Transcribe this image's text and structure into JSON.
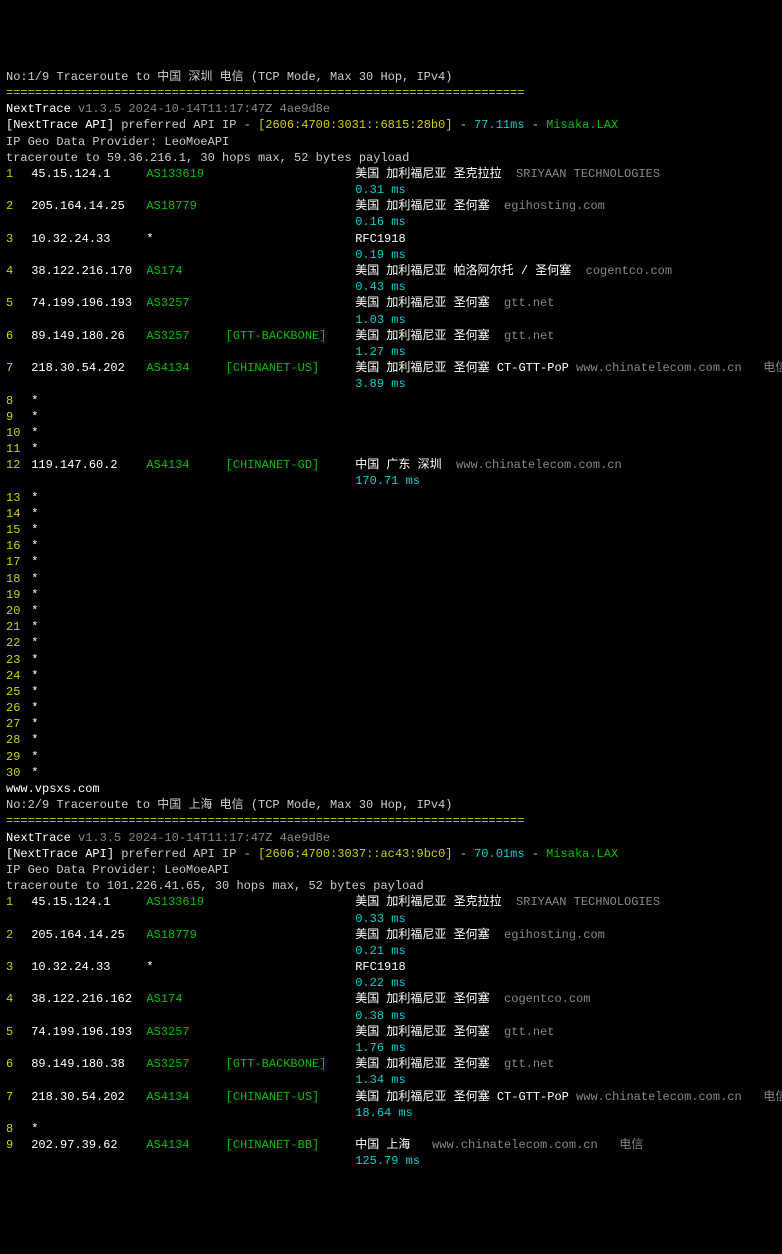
{
  "trace1": {
    "title": "No:1/9 Traceroute to 中国 深圳 电信 (TCP Mode, Max 30 Hop, IPv4)",
    "sep": "========================================================================",
    "nexttrace_label": "NextTrace",
    "nexttrace_ver": " v1.3.5 2024-10-14T11:17:47Z 4ae9d8e",
    "api1": "[NextTrace API]",
    "api2": " preferred API IP - ",
    "api_ip": "[2606:4700:3031::6815:28b0]",
    "api_sep": " - ",
    "api_lat": "77.11ms",
    "api_sep2": " - ",
    "api_loc": "Misaka.LAX",
    "provider": "IP Geo Data Provider: LeoMoeAPI",
    "cmd": "traceroute to 59.36.216.1, 30 hops max, 52 bytes payload",
    "hops": [
      {
        "n": "1",
        "ip": "45.15.124.1",
        "asn": "AS133619",
        "tag": "",
        "geo": "美国 加利福尼亚 圣克拉拉",
        "isp": "  SRIYAAN TECHNOLOGIES",
        "lat": "0.31 ms"
      },
      {
        "n": "2",
        "ip": "205.164.14.25",
        "asn": "AS18779",
        "tag": "",
        "geo": "美国 加利福尼亚 圣何塞",
        "isp": "  egihosting.com",
        "lat": "0.16 ms"
      },
      {
        "n": "3",
        "ip": "10.32.24.33",
        "asn": "*",
        "tag": "",
        "geo": "RFC1918",
        "isp": "",
        "lat": "0.19 ms"
      },
      {
        "n": "4",
        "ip": "38.122.216.170",
        "asn": "AS174",
        "tag": "",
        "geo": "美国 加利福尼亚 帕洛阿尔托 / 圣何塞",
        "isp": "  cogentco.com",
        "lat": "0.43 ms"
      },
      {
        "n": "5",
        "ip": "74.199.196.193",
        "asn": "AS3257",
        "tag": "",
        "geo": "美国 加利福尼亚 圣何塞",
        "isp": "  gtt.net",
        "lat": "1.03 ms"
      },
      {
        "n": "6",
        "ip": "89.149.180.26",
        "asn": "AS3257",
        "tag": "[GTT-BACKBONE]",
        "geo": "美国 加利福尼亚 圣何塞",
        "isp": "  gtt.net",
        "lat": "1.27 ms"
      },
      {
        "n": "7",
        "ip": "218.30.54.202",
        "asn": "AS4134",
        "tag": "[CHINANET-US]",
        "geo": "美国 加利福尼亚 圣何塞 CT-GTT-PoP",
        "isp": " www.chinatelecom.com.cn   电信",
        "lat": "3.89 ms"
      }
    ],
    "stars1": [
      "8",
      "9",
      "10",
      "11"
    ],
    "hop12": {
      "n": "12",
      "ip": "119.147.60.2",
      "asn": "AS4134",
      "tag": "[CHINANET-GD]",
      "geo": "中国 广东 深圳",
      "isp": "  www.chinatelecom.com.cn",
      "lat": "170.71 ms"
    },
    "stars2": [
      "13",
      "14",
      "15",
      "16",
      "17",
      "18",
      "19",
      "20",
      "21",
      "22",
      "23",
      "24",
      "25",
      "26",
      "27",
      "28",
      "29",
      "30"
    ],
    "watermark": "www.vpsxs.com"
  },
  "trace2": {
    "title": "No:2/9 Traceroute to 中国 上海 电信 (TCP Mode, Max 30 Hop, IPv4)",
    "sep": "========================================================================",
    "nexttrace_label": "NextTrace",
    "nexttrace_ver": " v1.3.5 2024-10-14T11:17:47Z 4ae9d8e",
    "api1": "[NextTrace API]",
    "api2": " preferred API IP - ",
    "api_ip": "[2606:4700:3037::ac43:9bc0]",
    "api_sep": " - ",
    "api_lat": "70.01ms",
    "api_sep2": " - ",
    "api_loc": "Misaka.LAX",
    "provider": "IP Geo Data Provider: LeoMoeAPI",
    "cmd": "traceroute to 101.226.41.65, 30 hops max, 52 bytes payload",
    "hops": [
      {
        "n": "1",
        "ip": "45.15.124.1",
        "asn": "AS133619",
        "tag": "",
        "geo": "美国 加利福尼亚 圣克拉拉",
        "isp": "  SRIYAAN TECHNOLOGIES",
        "lat": "0.33 ms"
      },
      {
        "n": "2",
        "ip": "205.164.14.25",
        "asn": "AS18779",
        "tag": "",
        "geo": "美国 加利福尼亚 圣何塞",
        "isp": "  egihosting.com",
        "lat": "0.21 ms"
      },
      {
        "n": "3",
        "ip": "10.32.24.33",
        "asn": "*",
        "tag": "",
        "geo": "RFC1918",
        "isp": "",
        "lat": "0.22 ms"
      },
      {
        "n": "4",
        "ip": "38.122.216.162",
        "asn": "AS174",
        "tag": "",
        "geo": "美国 加利福尼亚 圣何塞",
        "isp": "  cogentco.com",
        "lat": "0.38 ms"
      },
      {
        "n": "5",
        "ip": "74.199.196.193",
        "asn": "AS3257",
        "tag": "",
        "geo": "美国 加利福尼亚 圣何塞",
        "isp": "  gtt.net",
        "lat": "1.76 ms"
      },
      {
        "n": "6",
        "ip": "89.149.180.38",
        "asn": "AS3257",
        "tag": "[GTT-BACKBONE]",
        "geo": "美国 加利福尼亚 圣何塞",
        "isp": "  gtt.net",
        "lat": "1.34 ms"
      },
      {
        "n": "7",
        "ip": "218.30.54.202",
        "asn": "AS4134",
        "tag": "[CHINANET-US]",
        "geo": "美国 加利福尼亚 圣何塞 CT-GTT-PoP",
        "isp": " www.chinatelecom.com.cn   电信",
        "lat": "18.64 ms"
      }
    ],
    "stars1": [
      "8"
    ],
    "hop9": {
      "n": "9",
      "ip": "202.97.39.62",
      "asn": "AS4134",
      "tag": "[CHINANET-BB]",
      "geo": "中国 上海",
      "isp": "   www.chinatelecom.com.cn   电信",
      "lat": "125.79 ms"
    }
  }
}
